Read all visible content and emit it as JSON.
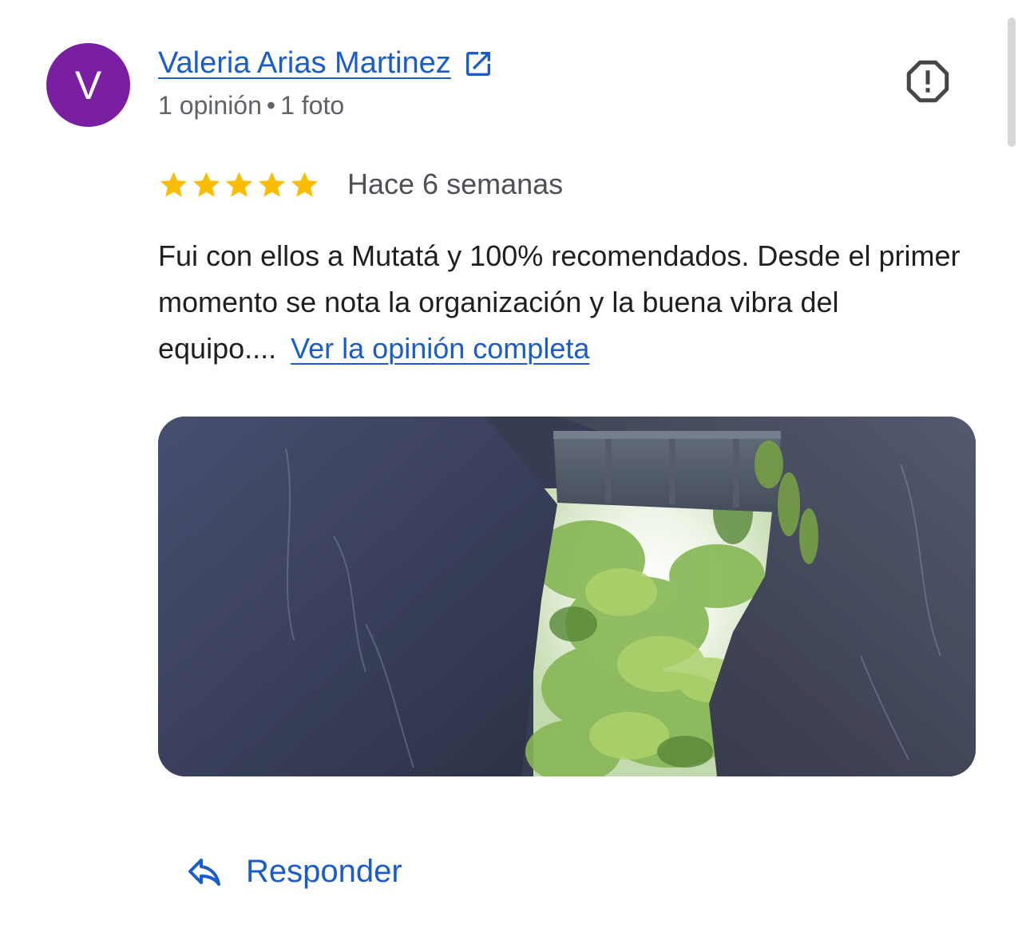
{
  "review": {
    "author": {
      "initial": "V",
      "name": "Valeria Arias Martinez",
      "reviews_count": "1 opinión",
      "photos_count": "1 foto",
      "separator": "•",
      "avatar_color": "#7b1fa2"
    },
    "rating": 5,
    "date": "Hace 6 semanas",
    "text": "Fui con ellos a Mutatá y 100% recomendados. Desde el primer momento se nota la organización y la buena vibra del equipo....",
    "more_label": "Ver la opinión completa",
    "photo": {
      "subject": "cave-opening-with-trees"
    },
    "icons": {
      "external": "open-in-new-icon",
      "report": "report-icon",
      "reply": "reply-icon",
      "star": "star-icon"
    }
  },
  "actions": {
    "reply_label": "Responder"
  },
  "colors": {
    "link": "#1a5ccc",
    "star": "#fbbc04",
    "meta_text": "#5f6368",
    "body_text": "#1f1f1f"
  }
}
